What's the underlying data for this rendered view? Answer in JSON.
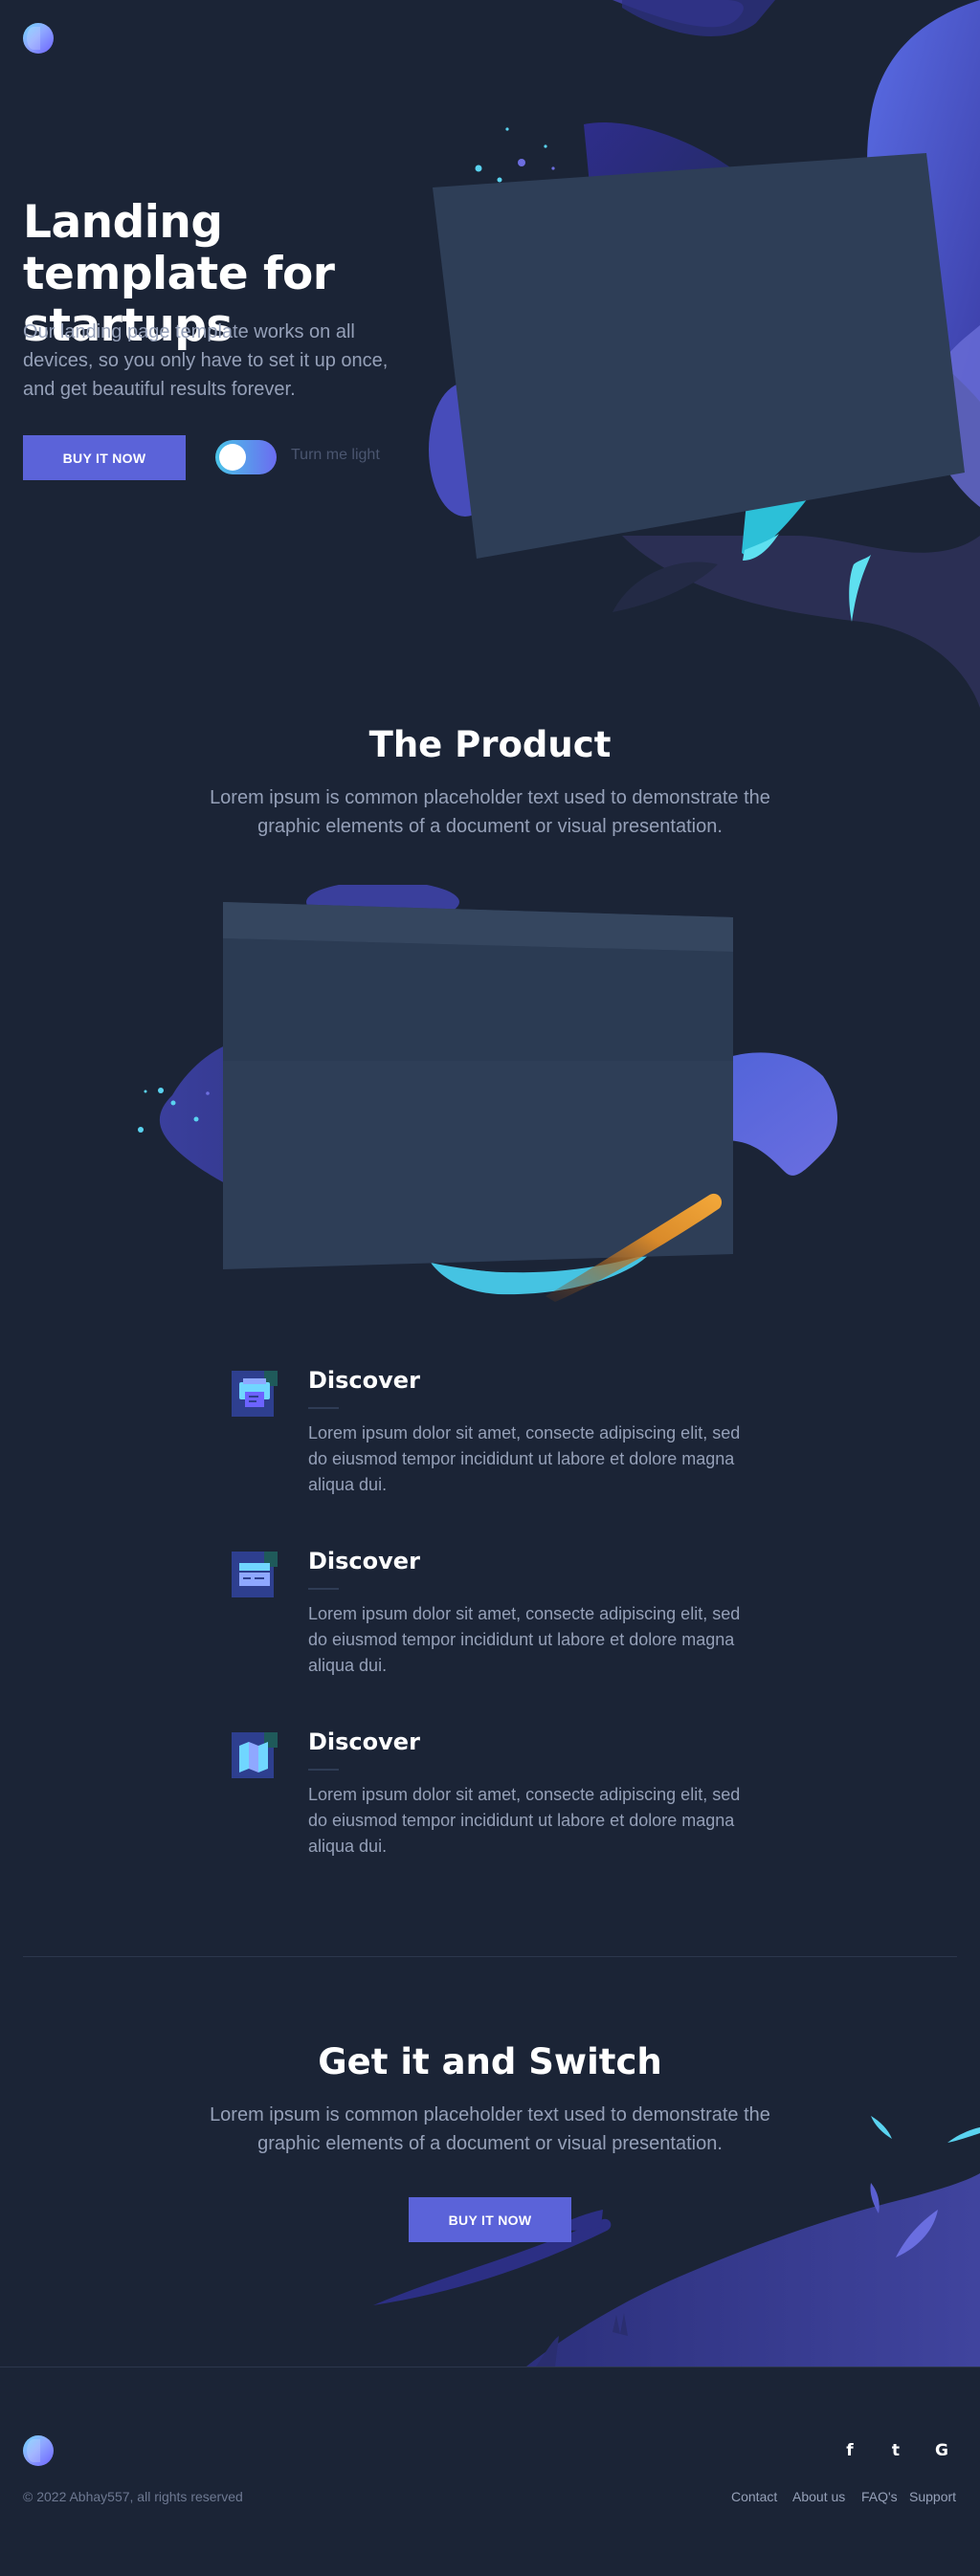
{
  "header": {
    "logo": "logo-icon"
  },
  "hero": {
    "title": "Landing template for startups",
    "description": "Our landing page template works on all devices, so you only have to set it up once, and get beautiful results forever.",
    "buy_button": "BUY IT NOW",
    "toggle_label": "Turn me light",
    "toggle_on": false
  },
  "product": {
    "title": "The Product",
    "description": "Lorem ipsum is common placeholder text used to demonstrate the graphic elements of a document or visual presentation."
  },
  "features": [
    {
      "icon": "printer-icon",
      "title": "Discover",
      "text": "Lorem ipsum dolor sit amet, consecte adipiscing elit, sed do eiusmod tempor incididunt ut labore et dolore magna aliqua dui."
    },
    {
      "icon": "card-icon",
      "title": "Discover",
      "text": "Lorem ipsum dolor sit amet, consecte adipiscing elit, sed do eiusmod tempor incididunt ut labore et dolore magna aliqua dui."
    },
    {
      "icon": "map-icon",
      "title": "Discover",
      "text": "Lorem ipsum dolor sit amet, consecte adipiscing elit, sed do eiusmod tempor incididunt ut labore et dolore magna aliqua dui."
    }
  ],
  "cta": {
    "title": "Get it and Switch",
    "description": "Lorem ipsum is common placeholder text used to demonstrate the graphic elements of a document or visual presentation.",
    "buy_button": "BUY IT NOW"
  },
  "footer": {
    "copyright": "© 2022 Abhay557, all rights reserved",
    "social": [
      {
        "icon": "facebook-icon",
        "glyph": "f"
      },
      {
        "icon": "twitter-icon",
        "glyph": "t"
      },
      {
        "icon": "google-icon",
        "glyph": "G"
      }
    ],
    "links": [
      "Contact",
      "About us",
      "FAQ's",
      "Support"
    ]
  },
  "colors": {
    "background": "#1b2436",
    "accent": "#5b63d9",
    "cyan": "#4ac4e8",
    "muted_text": "#95a0b8",
    "panel": "#2e3e57"
  }
}
